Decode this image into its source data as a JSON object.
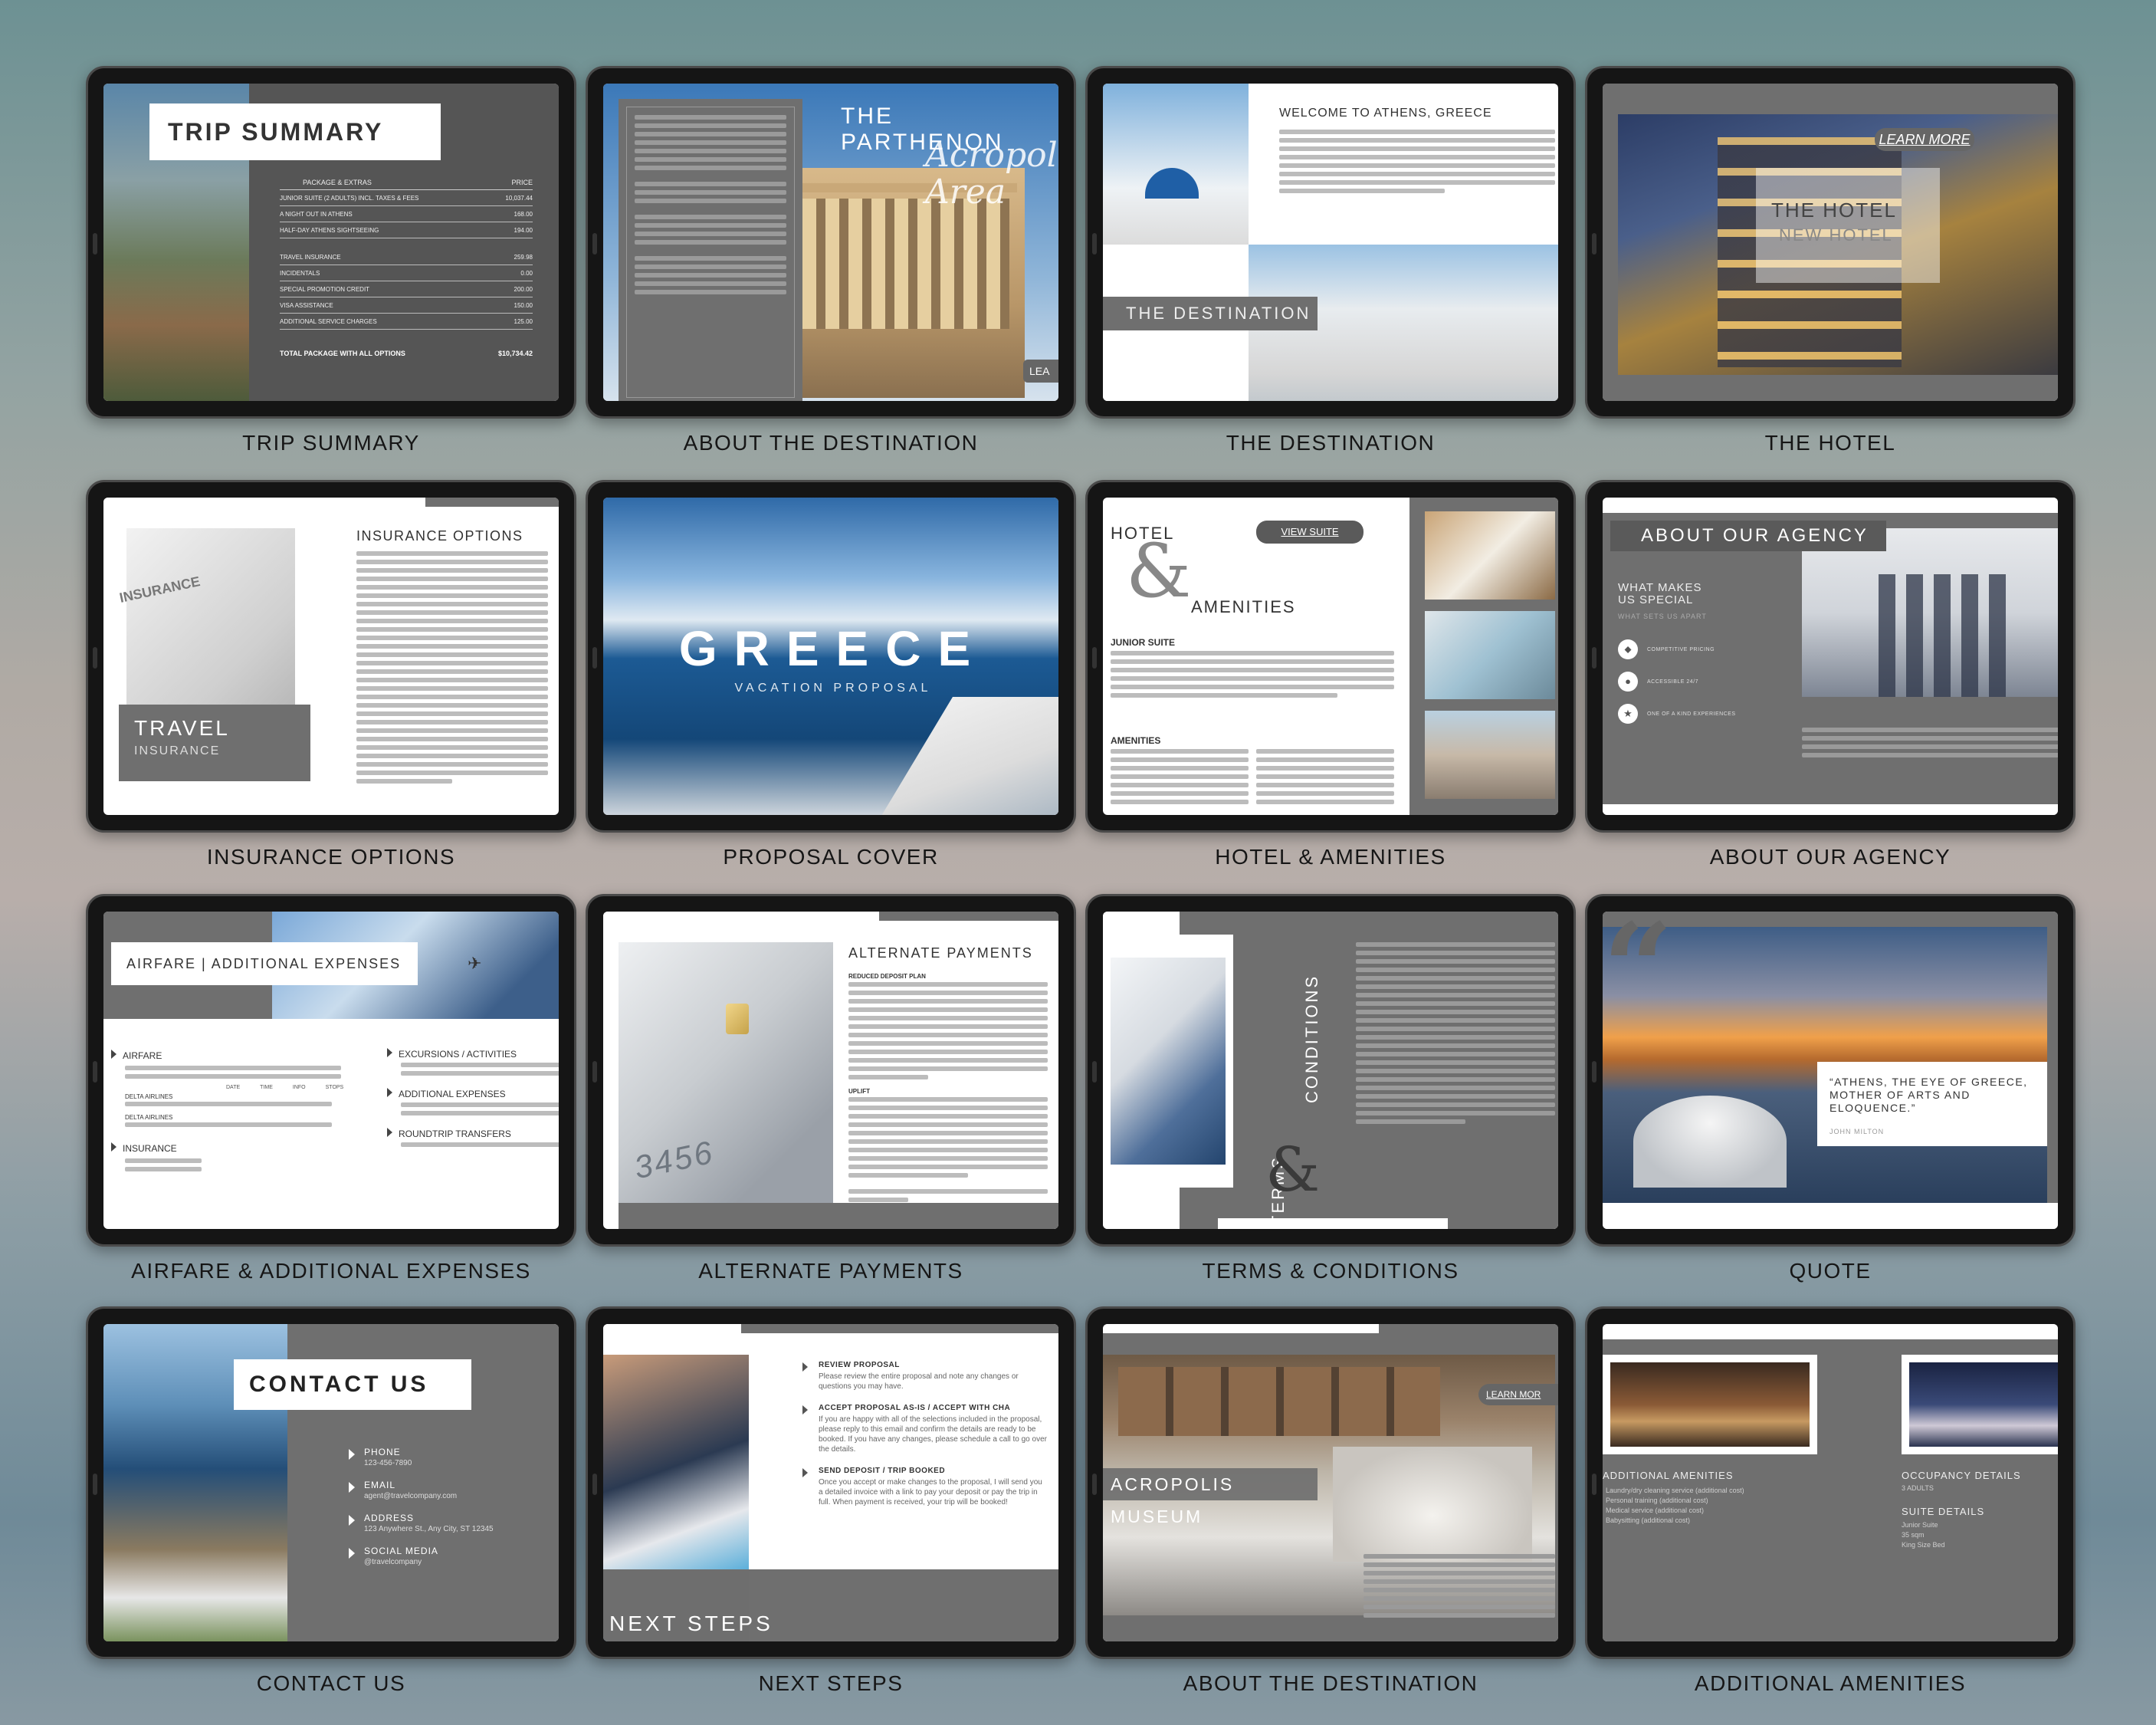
{
  "captions": [
    "TRIP SUMMARY",
    "ABOUT THE DESTINATION",
    "THE DESTINATION",
    "THE HOTEL",
    "INSURANCE OPTIONS",
    "PROPOSAL COVER",
    "HOTEL & AMENITIES",
    "ABOUT OUR AGENCY",
    "AIRFARE & ADDITIONAL EXPENSES",
    "ALTERNATE PAYMENTS",
    "TERMS & CONDITIONS",
    "QUOTE",
    "CONTACT US",
    "NEXT STEPS",
    "ABOUT THE DESTINATION",
    "ADDITIONAL AMENITIES"
  ],
  "trip_summary": {
    "title": "TRIP SUMMARY",
    "col_package": "PACKAGE & EXTRAS",
    "col_price": "PRICE",
    "rows": [
      {
        "item": "JUNIOR SUITE (2 ADULTS) INCL. TAXES & FEES",
        "price": "10,037.44"
      },
      {
        "item": "A NIGHT OUT IN ATHENS",
        "price": "168.00"
      },
      {
        "item": "HALF-DAY ATHENS SIGHTSEEING",
        "price": "194.00"
      },
      {
        "item": "TRAVEL INSURANCE",
        "price": "259.98"
      },
      {
        "item": "INCIDENTALS",
        "price": "0.00"
      },
      {
        "item": "SPECIAL PROMOTION CREDIT",
        "price": "200.00"
      },
      {
        "item": "VISA ASSISTANCE",
        "price": "150.00"
      },
      {
        "item": "ADDITIONAL SERVICE CHARGES",
        "price": "125.00"
      }
    ],
    "total_label": "TOTAL PACKAGE WITH ALL OPTIONS",
    "total_value": "$10,734.42"
  },
  "about_destination": {
    "title": "THE PARTHENON",
    "script": "Acropolis Area",
    "learn": "LEA"
  },
  "the_destination": {
    "heading": "WELCOME TO ATHENS, GREECE",
    "label": "THE DESTINATION"
  },
  "the_hotel": {
    "learn_more": "LEARN MORE",
    "title": "THE HOTEL",
    "subtitle": "NEW HOTEL"
  },
  "insurance": {
    "heading": "INSURANCE OPTIONS",
    "label_big": "TRAVEL",
    "label_small": "INSURANCE",
    "doc_word": "INSURANCE"
  },
  "cover": {
    "title": "GREECE",
    "subtitle": "VACATION PROPOSAL"
  },
  "hotel_amenities": {
    "hotel": "HOTEL",
    "amp": "&",
    "amenities": "AMENITIES",
    "view_suite": "VIEW SUITE",
    "junior_suite": "JUNIOR SUITE",
    "amenities_heading": "AMENITIES"
  },
  "agency": {
    "title": "ABOUT OUR AGENCY",
    "what_makes": "WHAT MAKES US SPECIAL",
    "what_sets": "WHAT SETS US APART",
    "features": [
      "COMPETITIVE PRICING",
      "ACCESSIBLE 24/7",
      "ONE OF A KIND EXPERIENCES"
    ]
  },
  "airfare": {
    "title": "AIRFARE | ADDITIONAL EXPENSES",
    "left": [
      "AIRFARE",
      "INSURANCE"
    ],
    "right": [
      "EXCURSIONS / ACTIVITIES",
      "ADDITIONAL EXPENSES",
      "ROUNDTRIP TRANSFERS"
    ],
    "cols": [
      "DATE",
      "TIME",
      "INFO",
      "STOPS"
    ],
    "airline": "DELTA AIRLINES"
  },
  "payments": {
    "heading": "ALTERNATE PAYMENTS",
    "sub1": "REDUCED DEPOSIT PLAN",
    "sub2": "UPLIFT",
    "card_digits": "3456"
  },
  "terms": {
    "terms": "TERMS",
    "amp": "&",
    "conditions": "CONDITIONS"
  },
  "quote": {
    "mark": "“",
    "text": "“ATHENS, THE EYE OF GREECE, MOTHER OF ARTS AND ELOQUENCE.”",
    "author": "JOHN MILTON"
  },
  "contact": {
    "title": "CONTACT US",
    "items": [
      {
        "label": "PHONE",
        "value": "123-456-7890"
      },
      {
        "label": "EMAIL",
        "value": "agent@travelcompany.com"
      },
      {
        "label": "ADDRESS",
        "value": "123 Anywhere St., Any City, ST 12345"
      },
      {
        "label": "SOCIAL MEDIA",
        "value": "@travelcompany"
      }
    ]
  },
  "next_steps": {
    "title": "NEXT STEPS",
    "steps": [
      {
        "head": "REVIEW PROPOSAL",
        "body": "Please review the entire proposal and note any changes or questions you may have."
      },
      {
        "head": "ACCEPT PROPOSAL AS-IS / ACCEPT WITH CHA",
        "body": "If you are happy with all of the selections included in the proposal, please reply to this email and confirm the details are ready to be booked. If you have any changes, please schedule a call to go over the details."
      },
      {
        "head": "SEND DEPOSIT / TRIP BOOKED",
        "body": "Once you accept or make changes to the proposal, I will send you a detailed invoice with a link to pay your deposit or pay the trip in full. When payment is received, your trip will be booked!"
      }
    ]
  },
  "museum": {
    "title": "ACROPOLIS MUSEUM",
    "learn_more": "LEARN MOR"
  },
  "additional_amenities": {
    "left_head": "ADDITIONAL AMENITIES",
    "left_items": [
      "Laundry/dry cleaning service (additional cost)",
      "Personal training (additional cost)",
      "Medical service (additional cost)",
      "Babysitting (additional cost)"
    ],
    "occ_head": "OCCUPANCY DETAILS",
    "occ_val": "3 ADULTS",
    "suite_head": "SUITE DETAILS",
    "suite_vals": [
      "Junior Suite",
      "35 sqm",
      "King Size Bed"
    ]
  },
  "colors": {
    "panel": "#6f6f6f",
    "panel_dark": "#555555",
    "bezel": "#151515"
  }
}
